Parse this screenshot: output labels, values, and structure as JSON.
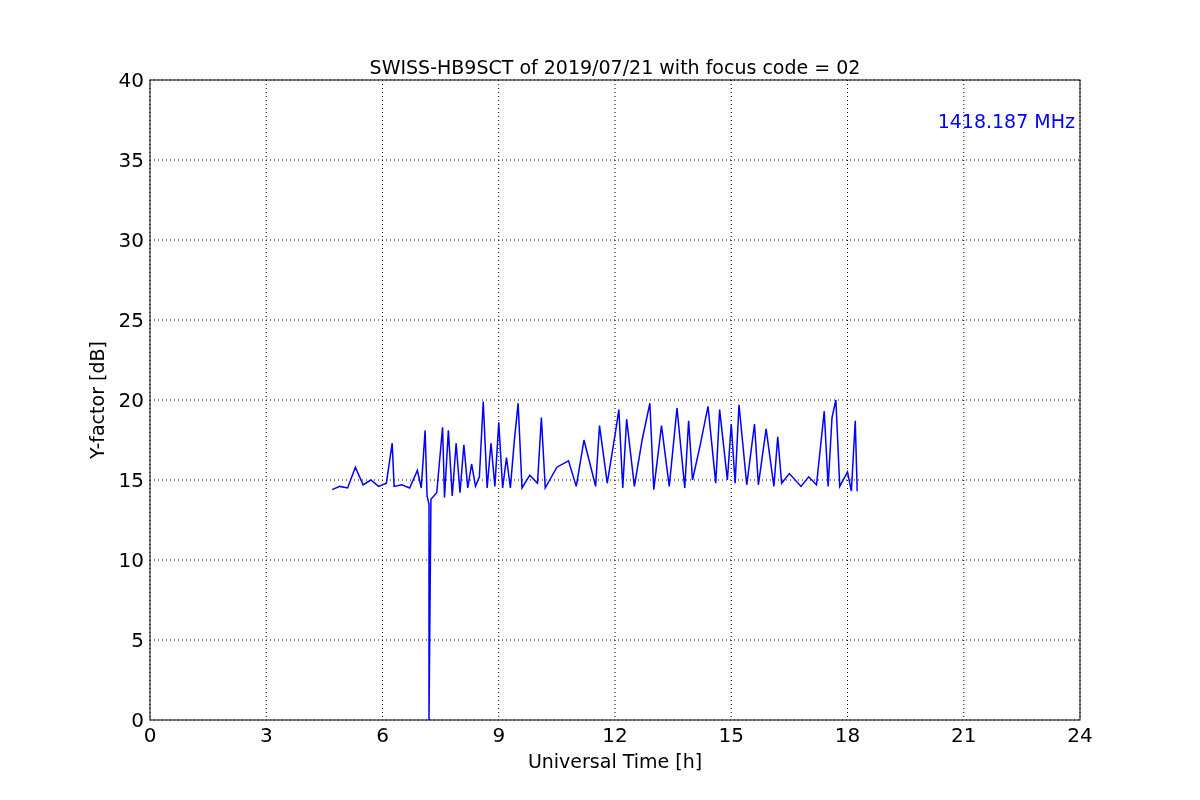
{
  "chart_data": {
    "type": "line",
    "title": "SWISS-HB9SCT of 2019/07/21 with focus code = 02",
    "xlabel": "Universal Time [h]",
    "ylabel": "Y-factor [dB]",
    "x": [
      4.7,
      4.9,
      5.1,
      5.3,
      5.5,
      5.7,
      5.9,
      6.1,
      6.25,
      6.3,
      6.5,
      6.7,
      6.9,
      7.0,
      7.1,
      7.15,
      7.2,
      7.2,
      7.25,
      7.4,
      7.55,
      7.6,
      7.7,
      7.8,
      7.9,
      8.0,
      8.1,
      8.2,
      8.3,
      8.4,
      8.5,
      8.6,
      8.7,
      8.8,
      8.9,
      9.0,
      9.1,
      9.2,
      9.3,
      9.4,
      9.5,
      9.6,
      9.8,
      10.0,
      10.1,
      10.2,
      10.5,
      10.8,
      11.0,
      11.2,
      11.5,
      11.6,
      11.8,
      12.0,
      12.1,
      12.2,
      12.3,
      12.5,
      12.7,
      12.9,
      13.0,
      13.2,
      13.4,
      13.6,
      13.8,
      13.9,
      14.0,
      14.2,
      14.4,
      14.6,
      14.7,
      14.9,
      15.0,
      15.1,
      15.2,
      15.4,
      15.6,
      15.7,
      15.9,
      16.1,
      16.2,
      16.3,
      16.5,
      16.8,
      17.0,
      17.2,
      17.4,
      17.5,
      17.6,
      17.7,
      17.8,
      18.0,
      18.1,
      18.2,
      18.25
    ],
    "series": [
      {
        "name": "1418.187 MHz",
        "color": "#0000ff",
        "values": [
          14.4,
          14.6,
          14.5,
          15.8,
          14.7,
          15.0,
          14.6,
          14.8,
          17.3,
          14.6,
          14.7,
          14.5,
          15.6,
          14.5,
          18.1,
          14.0,
          13.5,
          0,
          13.8,
          14.2,
          18.3,
          13.9,
          18.1,
          14.0,
          17.3,
          14.2,
          17.2,
          14.5,
          16.0,
          14.6,
          15.2,
          19.9,
          14.5,
          17.3,
          14.6,
          18.6,
          14.5,
          16.4,
          14.5,
          17.4,
          19.8,
          14.5,
          15.3,
          14.8,
          18.9,
          14.5,
          15.8,
          16.2,
          14.6,
          17.5,
          14.6,
          18.4,
          14.8,
          17.8,
          19.4,
          14.5,
          18.8,
          14.6,
          17.5,
          19.8,
          14.4,
          18.4,
          14.6,
          19.5,
          14.5,
          18.7,
          15.0,
          17.2,
          19.6,
          14.8,
          19.4,
          15.0,
          18.5,
          14.8,
          19.7,
          14.7,
          18.5,
          14.7,
          18.2,
          14.6,
          17.7,
          14.8,
          15.4,
          14.6,
          15.2,
          14.7,
          19.3,
          14.6,
          18.9,
          20.0,
          14.6,
          15.5,
          14.3,
          18.7,
          14.3
        ]
      }
    ],
    "xlim": [
      0,
      24
    ],
    "ylim": [
      0,
      40
    ],
    "xticks": [
      0,
      3,
      6,
      9,
      12,
      15,
      18,
      21,
      24
    ],
    "yticks": [
      0,
      5,
      10,
      15,
      20,
      25,
      30,
      35,
      40
    ],
    "grid": true
  }
}
